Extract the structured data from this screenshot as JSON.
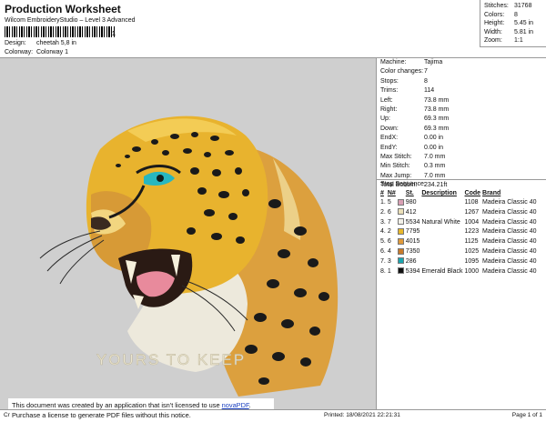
{
  "header": {
    "title": "Production Worksheet",
    "subtitle": "Wilcom EmbroideryStudio – Level 3 Advanced",
    "barcode_suffix": "1",
    "design_label": "Design:",
    "design_value": "cheetah 5,8 in",
    "colorway_label": "Colorway:",
    "colorway_value": "Colorway 1"
  },
  "stats": [
    {
      "k": "Stitches:",
      "v": "31768"
    },
    {
      "k": "Colors:",
      "v": "8"
    },
    {
      "k": "Height:",
      "v": "5.45 in"
    },
    {
      "k": "Width:",
      "v": "5.81 in"
    },
    {
      "k": "Zoom:",
      "v": "1:1"
    }
  ],
  "machine": [
    {
      "k": "Machine:",
      "v": "Tajima"
    },
    {
      "k": "Color changes:",
      "v": "7"
    },
    {
      "k": "Stops:",
      "v": "8"
    },
    {
      "k": "Trims:",
      "v": "114"
    },
    {
      "k": "Left:",
      "v": "73.8 mm"
    },
    {
      "k": "Right:",
      "v": "73.8 mm"
    },
    {
      "k": "Up:",
      "v": "69.3 mm"
    },
    {
      "k": "Down:",
      "v": "69.3 mm"
    },
    {
      "k": "EndX:",
      "v": "0.00 in"
    },
    {
      "k": "EndY:",
      "v": "0.00 in"
    },
    {
      "k": "Max Stitch:",
      "v": "7.0 mm"
    },
    {
      "k": "Min Stitch:",
      "v": "0.3 mm"
    },
    {
      "k": "Max Jump:",
      "v": "7.0 mm"
    },
    {
      "k": "Total Bobbin:",
      "v": "234.21ft"
    }
  ],
  "stop_sequence": {
    "label": "Stop Sequence:",
    "headers": [
      "#",
      "N#",
      "",
      "St.",
      "Description",
      "Code",
      "Brand"
    ],
    "rows": [
      {
        "n": "1.",
        "needle": "5",
        "color": "#d9a0b4",
        "st": "980",
        "desc": "",
        "code": "1108",
        "brand": "Madeira Classic 40"
      },
      {
        "n": "2.",
        "needle": "6",
        "color": "#eadfb8",
        "st": "412",
        "desc": "",
        "code": "1267",
        "brand": "Madeira Classic 40"
      },
      {
        "n": "3.",
        "needle": "7",
        "color": "#f2f0e8",
        "st": "5534",
        "desc": "Natural White",
        "code": "1004",
        "brand": "Madeira Classic 40"
      },
      {
        "n": "4.",
        "needle": "2",
        "color": "#e8b72a",
        "st": "7795",
        "desc": "",
        "code": "1223",
        "brand": "Madeira Classic 40"
      },
      {
        "n": "5.",
        "needle": "6",
        "color": "#e09a3a",
        "st": "4015",
        "desc": "",
        "code": "1125",
        "brand": "Madeira Classic 40"
      },
      {
        "n": "6.",
        "needle": "4",
        "color": "#c87a2a",
        "st": "7350",
        "desc": "",
        "code": "1025",
        "brand": "Madeira Classic 40"
      },
      {
        "n": "7.",
        "needle": "3",
        "color": "#1aa6b0",
        "st": "286",
        "desc": "",
        "code": "1095",
        "brand": "Madeira Classic 40"
      },
      {
        "n": "8.",
        "needle": "1",
        "color": "#111111",
        "st": "5394",
        "desc": "Emerald Black",
        "code": "1000",
        "brand": "Madeira Classic 40"
      }
    ]
  },
  "design": {
    "caption": "YOURS TO KEEP"
  },
  "notice": {
    "line1_pre": "This document was created by an application that isn't licensed to use ",
    "line1_link": "novaPDF",
    "line1_post": ".",
    "line2": "Purchase a license to generate PDF files without this notice."
  },
  "footer": {
    "left": "Cr",
    "printed": "Printed: 18/08/2021 22:21:31",
    "page": "Page 1 of 1"
  }
}
